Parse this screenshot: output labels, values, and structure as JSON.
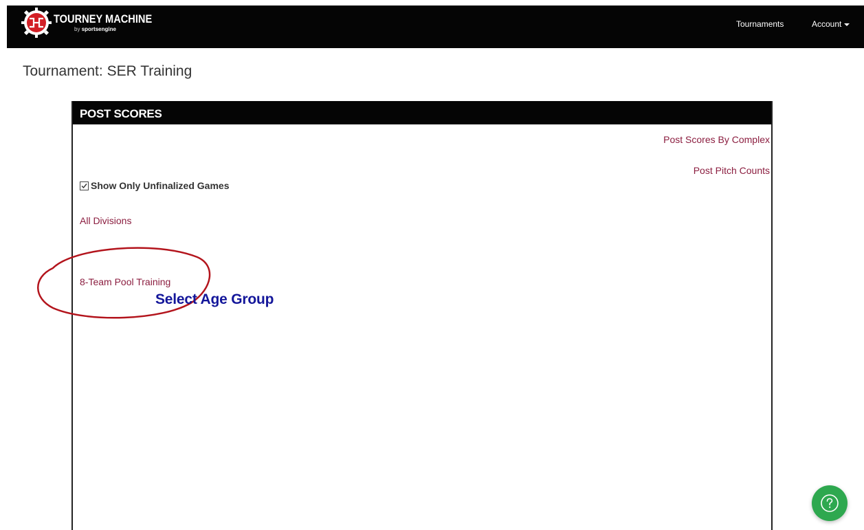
{
  "nav": {
    "brand_title": "TOURNEY MACHINE",
    "brand_sub_prefix": "by",
    "brand_sub_name": "sportsengine",
    "tournaments": "Tournaments",
    "account": "Account"
  },
  "page": {
    "tournament_title": "Tournament: SER Training"
  },
  "panel": {
    "header": "POST SCORES",
    "post_scores_by_complex": "Post Scores By Complex",
    "post_pitch_counts": "Post Pitch Counts",
    "show_only_unfinalized": "Show Only Unfinalized Games",
    "show_only_unfinalized_checked": true,
    "all_divisions": "All Divisions",
    "division_link": "8-Team Pool Training"
  },
  "annotation": {
    "text": "Select Age Group",
    "circle_color": "#b3141c",
    "text_color": "#13169a"
  },
  "help": {
    "icon": "question-circle-icon",
    "color": "#2ea84f"
  },
  "colors": {
    "link": "#8b1d3f",
    "header_bg": "#050505"
  }
}
